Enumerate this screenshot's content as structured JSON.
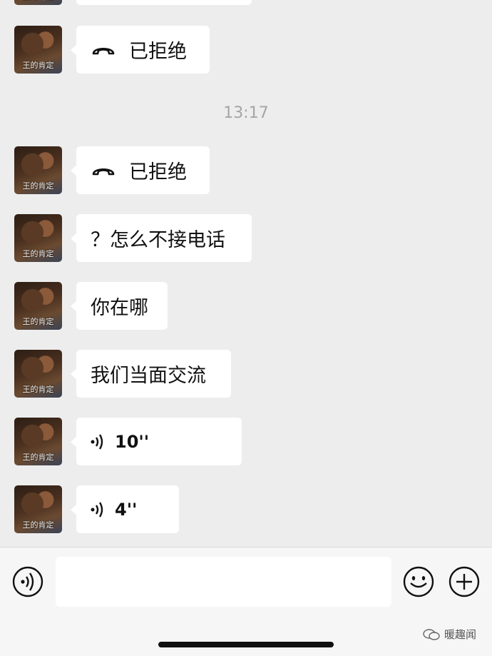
{
  "contact": {
    "avatar_caption": "王的肯定"
  },
  "timestamp": "13:17",
  "messages": [
    {
      "type": "call",
      "text": "已拒绝"
    },
    {
      "type": "call",
      "text": "已拒绝"
    },
    {
      "type": "text",
      "text": "？怎么不接电话"
    },
    {
      "type": "text",
      "text": "你在哪"
    },
    {
      "type": "text",
      "text": "我们当面交流"
    },
    {
      "type": "voice",
      "text": "10''"
    },
    {
      "type": "voice",
      "text": "4''"
    }
  ],
  "input_bar": {
    "input_value": "",
    "icons": [
      "voice-toggle-icon",
      "emoji-icon",
      "plus-icon"
    ]
  },
  "watermark": "暖趣闻"
}
